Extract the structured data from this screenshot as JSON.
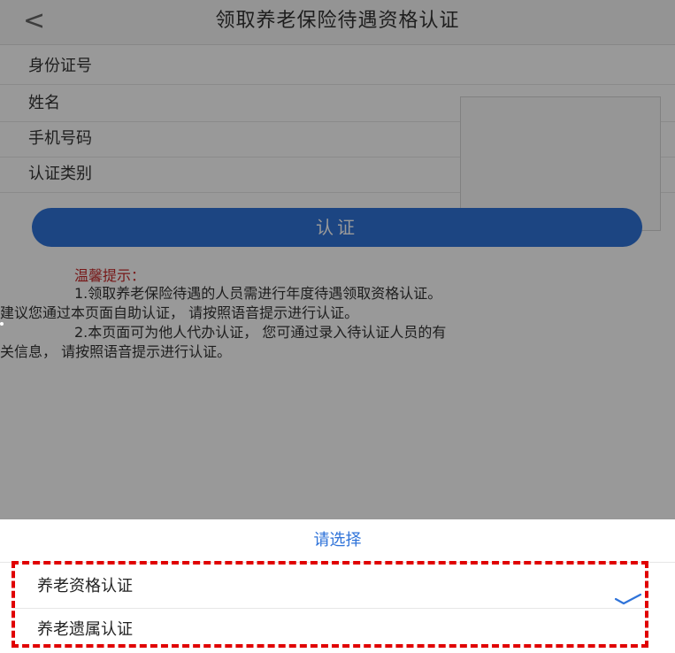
{
  "nav": {
    "back_label": "<",
    "title": "领取养老保险待遇资格认证"
  },
  "form": {
    "fields": [
      {
        "label": "身份证号"
      },
      {
        "label": "姓名"
      },
      {
        "label": "手机号码"
      },
      {
        "label": "认证类别"
      }
    ],
    "submit_label": "认证"
  },
  "tips": {
    "title": "温馨提示：",
    "lines": [
      "1.领取养老保险待遇的人员需进行年度待遇领取资格认证。",
      "建议您通过本页面自助认证， 请按照语音提示进行认证。",
      "2.本页面可为他人代办认证， 您可通过录入待认证人员的有",
      "关信息， 请按照语音提示进行认证。"
    ]
  },
  "picker": {
    "title": "请选择",
    "options": [
      {
        "label": "养老资格认证",
        "selected": true
      },
      {
        "label": "养老遗属认证",
        "selected": false
      }
    ]
  },
  "colors": {
    "accent": "#2f73d9",
    "tip_title": "#c62828",
    "highlight": "#e00000"
  }
}
